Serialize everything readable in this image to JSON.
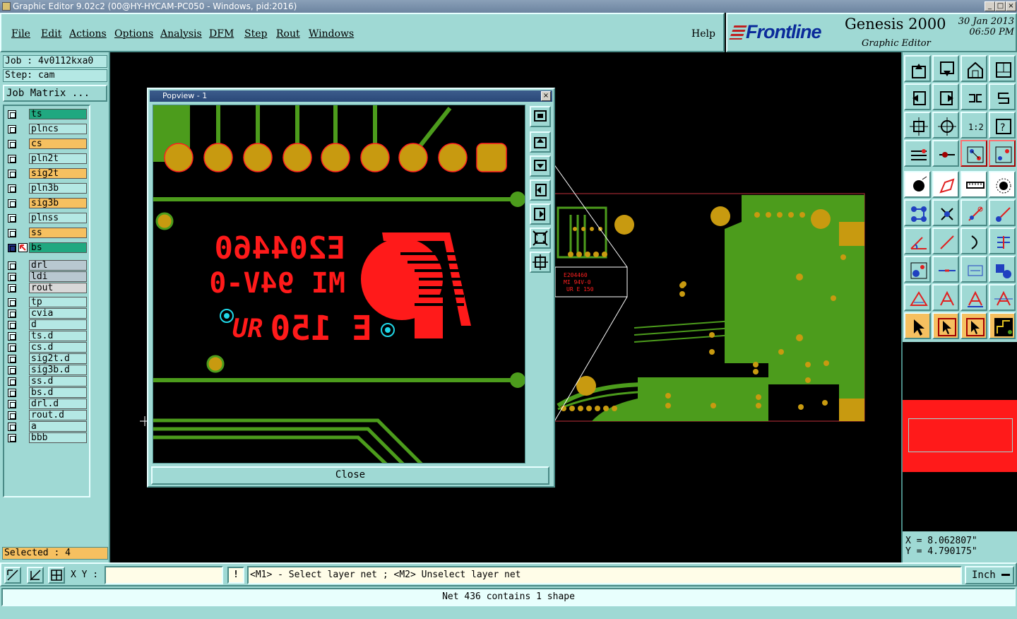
{
  "window": {
    "title": "Graphic Editor 9.02c2 (00@HY-HYCAM-PC050 - Windows, pid:2016)"
  },
  "menu": [
    "File",
    "Edit",
    "Actions",
    "Options",
    "Analysis",
    "DFM",
    "Step",
    "Rout",
    "Windows"
  ],
  "help_label": "Help",
  "brand": {
    "logo": "Frontline",
    "product": "Genesis 2000",
    "subtitle": "Graphic Editor",
    "date": "30 Jan 2013",
    "time": "06:50 PM"
  },
  "job": {
    "job_label": "Job : 4v0112kxa0",
    "step_label": "Step: cam",
    "matrix_button": "Job Matrix ..."
  },
  "layers": [
    {
      "name": "ts",
      "color": "#20a880"
    },
    {
      "name": "plncs",
      "color": "#b4e8e4"
    },
    {
      "name": "cs",
      "color": "#f6c060"
    },
    {
      "name": "pln2t",
      "color": "#b4e8e4"
    },
    {
      "name": "sig2t",
      "color": "#f6c060"
    },
    {
      "name": "pln3b",
      "color": "#b4e8e4"
    },
    {
      "name": "sig3b",
      "color": "#f6c060"
    },
    {
      "name": "plnss",
      "color": "#b4e8e4"
    },
    {
      "name": "ss",
      "color": "#f6c060"
    },
    {
      "name": "bs",
      "color": "#20a880"
    },
    {
      "name": "drl",
      "color": "#b8c8d0"
    },
    {
      "name": "ldi",
      "color": "#b8c8d0"
    },
    {
      "name": "rout",
      "color": "#d8d8d8"
    },
    {
      "name": "tp",
      "color": "#b4e8e4"
    },
    {
      "name": "cvia",
      "color": "#b4e8e4"
    },
    {
      "name": "d",
      "color": "#b4e8e4"
    },
    {
      "name": "ts.d",
      "color": "#b4e8e4"
    },
    {
      "name": "cs.d",
      "color": "#b4e8e4"
    },
    {
      "name": "sig2t.d",
      "color": "#b4e8e4"
    },
    {
      "name": "sig3b.d",
      "color": "#b4e8e4"
    },
    {
      "name": "ss.d",
      "color": "#b4e8e4"
    },
    {
      "name": "bs.d",
      "color": "#b4e8e4"
    },
    {
      "name": "drl.d",
      "color": "#b4e8e4"
    },
    {
      "name": "rout.d",
      "color": "#b4e8e4"
    },
    {
      "name": "a",
      "color": "#b4e8e4"
    },
    {
      "name": "bbb",
      "color": "#b4e8e4"
    }
  ],
  "selected": "Selected : 4",
  "popview": {
    "title": "Popview - 1",
    "close_button": "Close",
    "silk_line1": "E204460",
    "silk_line2": "MI 94V-0",
    "silk_line3": "UR",
    "silk_line4": "E 150"
  },
  "coords": {
    "x": "X = 8.062807\"",
    "y": "Y = 4.790175\""
  },
  "bottom": {
    "xy_label": "X Y :",
    "xy_value": "",
    "warn": "!",
    "hint": "<M1> - Select layer net ; <M2> Unselect layer net",
    "unit": "Inch"
  },
  "status": "Net 436 contains 1 shape",
  "colors": {
    "panel": "#9fd9d4",
    "copper": "#4c9c1c",
    "pad": "#c89a10",
    "silk": "#ff1a1a",
    "highlight": "#f6c060"
  }
}
